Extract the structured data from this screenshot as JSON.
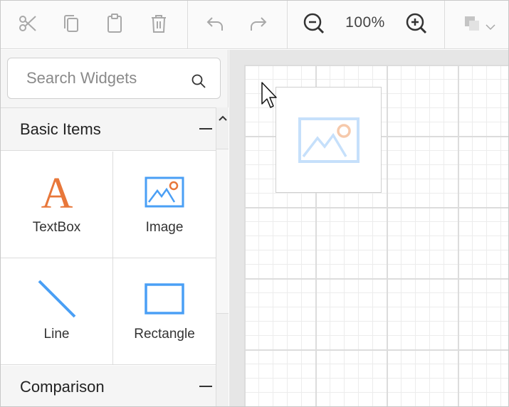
{
  "toolbar": {
    "buttons": [
      {
        "name": "cut-button",
        "icon": "scissors-icon"
      },
      {
        "name": "copy-button",
        "icon": "copy-icon"
      },
      {
        "name": "paste-button",
        "icon": "clipboard-icon"
      },
      {
        "name": "delete-button",
        "icon": "trash-icon"
      },
      {
        "name": "undo-button",
        "icon": "undo-icon"
      },
      {
        "name": "redo-button",
        "icon": "redo-icon"
      },
      {
        "name": "zoom-out-button",
        "icon": "zoom-out-icon"
      },
      {
        "name": "zoom-in-button",
        "icon": "zoom-in-icon"
      },
      {
        "name": "layer-order-dropdown",
        "icon": "layers-icon"
      }
    ],
    "zoom_level": "100%"
  },
  "search": {
    "placeholder": "Search Widgets",
    "value": ""
  },
  "widget_panel": {
    "groups": [
      {
        "title": "Basic Items",
        "collapsed": false,
        "items": [
          {
            "label": "TextBox",
            "icon": "textbox-icon"
          },
          {
            "label": "Image",
            "icon": "image-icon"
          },
          {
            "label": "Line",
            "icon": "line-icon"
          },
          {
            "label": "Rectangle",
            "icon": "rectangle-icon"
          }
        ]
      },
      {
        "title": "Comparison",
        "collapsed": false,
        "items": []
      }
    ]
  },
  "design_canvas": {
    "placed_items": [
      {
        "type": "image",
        "icon": "image-placeholder-icon"
      }
    ]
  },
  "colors": {
    "accent_blue": "#4a9ff5",
    "accent_orange": "#e8773a",
    "icon_gray": "#a8a8a8",
    "icon_dark": "#333333"
  }
}
